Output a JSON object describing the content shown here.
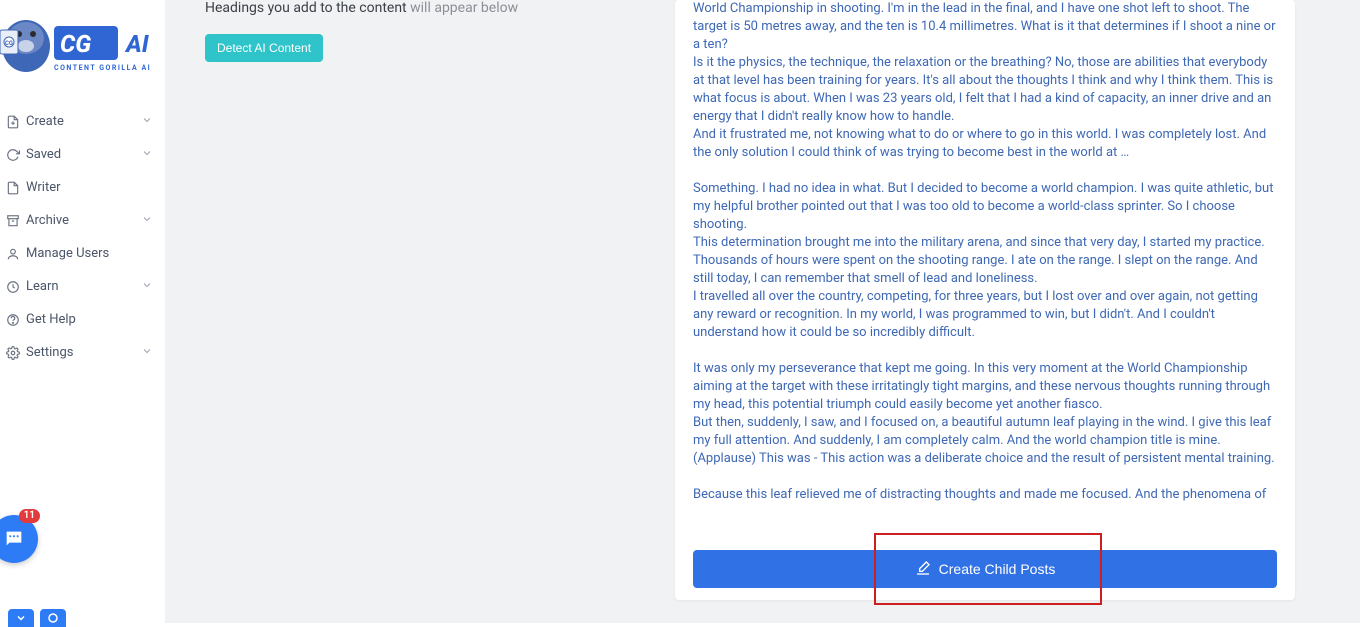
{
  "brand": {
    "name": "CONTENT GORILLA AI",
    "tag": "AI"
  },
  "sidebar": {
    "items": [
      {
        "label": "Create",
        "icon": "file-plus-icon",
        "chev": true
      },
      {
        "label": "Saved",
        "icon": "refresh-icon",
        "chev": true
      },
      {
        "label": "Writer",
        "icon": "doc-icon",
        "chev": false
      },
      {
        "label": "Archive",
        "icon": "archive-icon",
        "chev": true
      },
      {
        "label": "Manage Users",
        "icon": "user-icon",
        "chev": false
      },
      {
        "label": "Learn",
        "icon": "clock-icon",
        "chev": true
      },
      {
        "label": "Get Help",
        "icon": "help-icon",
        "chev": false
      },
      {
        "label": "Settings",
        "icon": "gear-icon",
        "chev": true
      }
    ]
  },
  "left_panel": {
    "headings_line_a": "Headings you add to the content ",
    "headings_line_b": "will appear below",
    "detect_btn": "Detect AI Content"
  },
  "editor": {
    "p1": "World Championship in shooting. I'm in the lead in the final, and I have one shot left to shoot. The target is 50 metres away, and the ten is 10.4 millimetres. What is it that determines if I shoot a nine or a ten?",
    "p2": " Is it the physics, the technique, the relaxation or the breathing? No, those are abilities that everybody at that level has been training for years. It's all about the thoughts I think and why I think them. This is what focus is about. When I was 23 years old, I felt that I had a kind of capacity, an inner drive and an energy that I didn't really know how to handle.",
    "p3": " And it frustrated me, not knowing what to do or where to go in this world. I was completely lost. And the only solution I could think of was trying to become best in the world at …",
    "p4": "Something. I had no idea in what. But I decided to become a world champion. I was quite athletic, but my helpful brother pointed out that I was too old to become a world-class sprinter. So I choose shooting.",
    "p5": " This determination brought me into the military arena, and since that very day, I started my practice. Thousands of hours were spent on the shooting range. I ate on the range. I slept on the range. And still today, I can remember that smell of lead and loneliness.",
    "p6": " I travelled all over the country, competing, for three years, but I lost over and over again, not getting any reward or recognition. In my world, I was programmed to win, but I didn't. And I couldn't understand how it could be so incredibly difficult.",
    "p7": "It was only my perseverance that kept me going. In this very moment at the World Championship aiming at the target with these irritatingly tight margins, and these nervous thoughts running through my head, this potential triumph could easily become yet another fiasco.",
    "p8": " But then, suddenly, I saw, and I focused on, a beautiful autumn leaf playing in the wind. I give this leaf my full attention. And suddenly, I am completely calm. And the world champion title is mine. (Applause) This was - This action was a deliberate choice and the result of persistent mental training.",
    "p9": "Because this leaf relieved me of distracting thoughts and made me focused. And the phenomena of",
    "create_btn": "Create Child Posts"
  },
  "chat": {
    "badge": "11"
  },
  "colors": {
    "accent": "#3171e6"
  }
}
